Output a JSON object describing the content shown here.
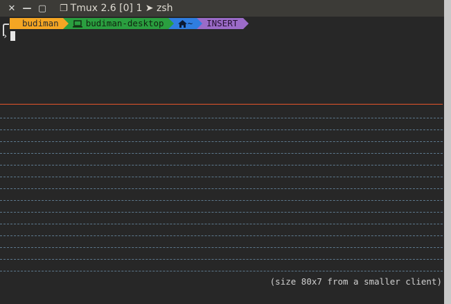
{
  "titlebar": {
    "close_glyph": "✕",
    "minimize_glyph": "—",
    "maximize_glyph": "▢",
    "window_icon": "❐",
    "title": "Tmux 2.6 [0] 1 ➤ zsh"
  },
  "prompt": {
    "user": "budiman",
    "host_icon": "laptop-icon",
    "host": "budiman-desktop",
    "dir_icon": "home-icon",
    "dir": "~",
    "mode": "INSERT",
    "input_chevron": "›"
  },
  "colors": {
    "background": "#272727",
    "user": "#f5a623",
    "host": "#2a9e3f",
    "dir": "#2f7de0",
    "mode": "#9b6bc8",
    "separator": "#e8552a"
  },
  "status_message": "(size 80x7 from a smaller client)"
}
